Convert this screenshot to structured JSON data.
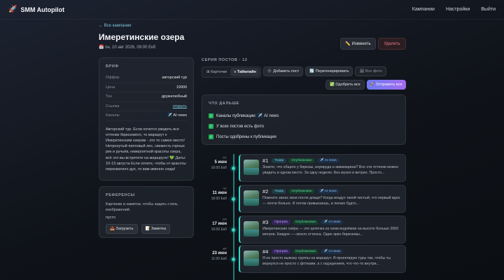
{
  "app": {
    "icon": "rocket-icon",
    "title": "SMM Autopilot"
  },
  "nav": [
    "Кампании",
    "Настройки",
    "Выйти"
  ],
  "back_label": "← Все кампании",
  "page": {
    "title": "Имеретинские озера",
    "date": "📅 пн, 10 авг 2026, 09:00 Екб"
  },
  "actions": {
    "edit": "✏️ Изменить",
    "delete": "Удалить"
  },
  "brief": {
    "heading": "БРИФ",
    "rows": [
      {
        "k": "Оффер",
        "v": "авторский тур"
      },
      {
        "k": "Цена",
        "v": "19900"
      },
      {
        "k": "Тон",
        "v": "дружелюбный"
      },
      {
        "k": "Ссылка",
        "v": "открыть"
      },
      {
        "k": "Каналы",
        "v": "✈️ AI news"
      }
    ],
    "text": "Авторский тур. Если хочется увидеть все оттенки бирюзового, то маршрут к Имеретинским озерам - это то самое место! Нетронутый пихтовый лес, свежесть горных рек и ручьёв, невероятной красоты озера, всё это вы встретите на маршруте! 💚 Даты: 10-13 августа Если хотите, чтобы от красоты перехватило дух, то вам именно сюда!"
  },
  "refs": {
    "heading": "РЕФЕРЕНСЫ",
    "desc": "Картинки и заметки, чтобы задать стиль изображений.",
    "empty": "пусто",
    "upload": "📤 Загрузить",
    "note": "📝 Заметка"
  },
  "series": {
    "heading": "СЕРИЯ ПОСТОВ · 12",
    "view_cards": "⊞ Карточки",
    "view_timeline": "≡ Таймлайн",
    "add_post": "➕ Добавить пост",
    "regenerate": "🔄 Перегенерировать",
    "all_photos": "🖼 Все фото",
    "approve_all": "✅ Одобрить все",
    "send_all": "🚀 Отправить все"
  },
  "next": {
    "heading": "ЧТО ДАЛЬШЕ",
    "items": [
      "Каналы публикации: ✈️ AI news",
      "У всех постов есть фото",
      "Посты одобрены к публикации"
    ]
  },
  "posts": [
    {
      "dow": "ПТ",
      "day": "5 июн",
      "time": "16:00 Екб",
      "num": "#1",
      "type": "Тизер",
      "type_kind": "tease",
      "status": "Опубликован",
      "channel": "✈️ AI news",
      "text": "Знаете, что общего у бирюзы, изумруда и аквамарина? Все эти оттенки можно увидеть в одном месте. За одну неделю. Без музея и витрин. Просто..."
    },
    {
      "dow": "ЧТ",
      "day": "11 июн",
      "time": "16:00 Екб",
      "num": "#2",
      "type": "Тизер",
      "type_kind": "tease",
      "status": "Опубликован",
      "channel": "✈️ AI news",
      "text": "Помните запах хвои после дождя? Когда воздух такой чистый, что первый вдох — почти больно. Я потом привыкаешь, и легкие будто..."
    },
    {
      "dow": "СР",
      "day": "17 июн",
      "time": "16:00 Екб",
      "num": "#3",
      "type": "Прогрев",
      "type_kind": "prog",
      "status": "Опубликован",
      "channel": "✈️ AI news",
      "text": "Имеретинские озёра — это цепочка из семи водоёмов на высоте больше 2500 метров. Каждое — своего оттенка. Один ярко-бирюзовы..."
    },
    {
      "dow": "ВТ",
      "day": "23 июн",
      "time": "11:00 Екб",
      "num": "#4",
      "type": "Прогрев",
      "type_kind": "prog",
      "status": "Опубликован",
      "channel": "✈️ AI news",
      "text": "Я не просто вывожу группы на маршрут. Я проектирую туры так, чтобы ты вернулся не просто с фотками, а с ощущением, что что-то внутри..."
    }
  ]
}
